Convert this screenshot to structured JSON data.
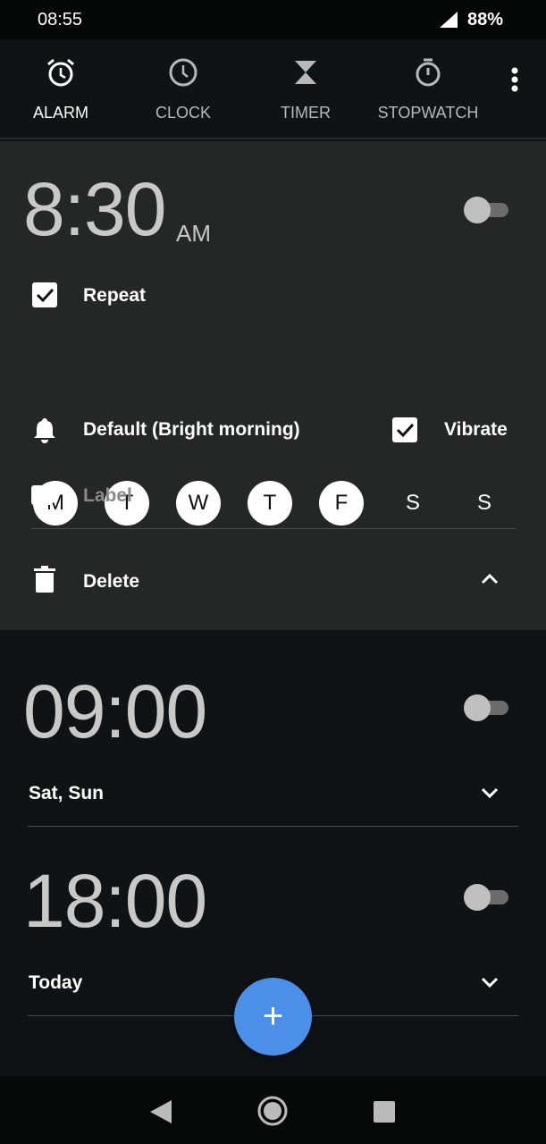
{
  "status_bar": {
    "time": "08:55",
    "battery": "88%"
  },
  "tabs": [
    {
      "label": "ALARM",
      "icon": "alarm-icon",
      "active": true
    },
    {
      "label": "CLOCK",
      "icon": "clock-icon"
    },
    {
      "label": "TIMER",
      "icon": "hourglass-icon"
    },
    {
      "label": "STOPWATCH",
      "icon": "stopwatch-icon"
    }
  ],
  "alarms": [
    {
      "time": "8:30",
      "ampm": "AM",
      "enabled": false,
      "repeat_label": "Repeat",
      "repeat": true,
      "days": [
        {
          "d": "M",
          "on": true
        },
        {
          "d": "T",
          "on": true
        },
        {
          "d": "W",
          "on": true
        },
        {
          "d": "T",
          "on": true
        },
        {
          "d": "F",
          "on": true
        },
        {
          "d": "S",
          "on": false
        },
        {
          "d": "S",
          "on": false
        }
      ],
      "ringtone": "Default (Bright morning)",
      "vibrate_label": "Vibrate",
      "vibrate": true,
      "label_placeholder": "Label",
      "delete_label": "Delete"
    },
    {
      "time": "09:00",
      "enabled": false,
      "summary": "Sat, Sun"
    },
    {
      "time": "18:00",
      "enabled": false,
      "summary": "Today"
    }
  ],
  "fab": {
    "label": "+",
    "color": "#4b8fe8"
  }
}
